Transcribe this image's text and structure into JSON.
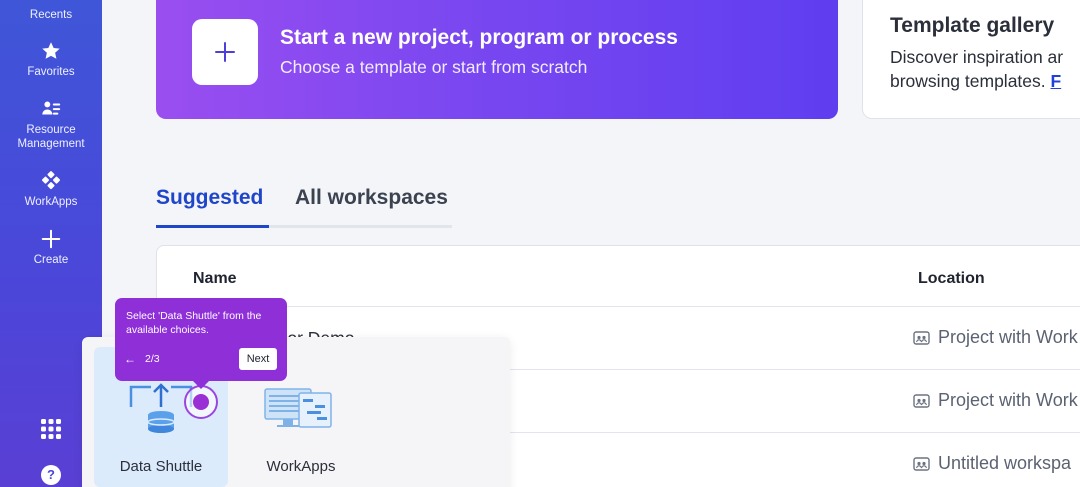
{
  "sidebar": {
    "items": [
      {
        "label": "Recents",
        "icon": "clock-icon"
      },
      {
        "label": "Favorites",
        "icon": "star-icon"
      },
      {
        "label": "Resource Management",
        "icon": "people-icon"
      },
      {
        "label": "WorkApps",
        "icon": "workapps-icon"
      },
      {
        "label": "Create",
        "icon": "plus-icon"
      }
    ],
    "bottom": [
      {
        "icon": "app-grid-icon"
      },
      {
        "icon": "help-icon",
        "text": "?"
      }
    ]
  },
  "hero": {
    "title": "Start a new project, program or process",
    "subtitle": "Choose a template or start from scratch"
  },
  "gallery": {
    "title": "Template gallery",
    "line1": "Discover inspiration ar",
    "line2": "browsing templates. ",
    "link": "F"
  },
  "tabs": {
    "suggested": "Suggested",
    "all": "All workspaces"
  },
  "table": {
    "headers": {
      "name": "Name",
      "location": "Location"
    },
    "rows": [
      {
        "name": "of Sample For Demo",
        "location": "Project with Work"
      },
      {
        "name": "",
        "location": "Project with Work"
      },
      {
        "name": "",
        "location": "Untitled workspa"
      }
    ]
  },
  "popover": {
    "apps": [
      {
        "label": "Data Shuttle",
        "icon": "data-shuttle-icon"
      },
      {
        "label": "WorkApps",
        "icon": "workapps-screens-icon"
      }
    ]
  },
  "tooltip": {
    "text": "Select 'Data Shuttle' from the available choices.",
    "back": "←",
    "step": "2/3",
    "next": "Next"
  },
  "colors": {
    "sidebar": "#4a47d9",
    "hero_start": "#9a4ef0",
    "hero_end": "#5f3ef0",
    "accent": "#1f46c9",
    "tooltip": "#8f2fd8"
  }
}
